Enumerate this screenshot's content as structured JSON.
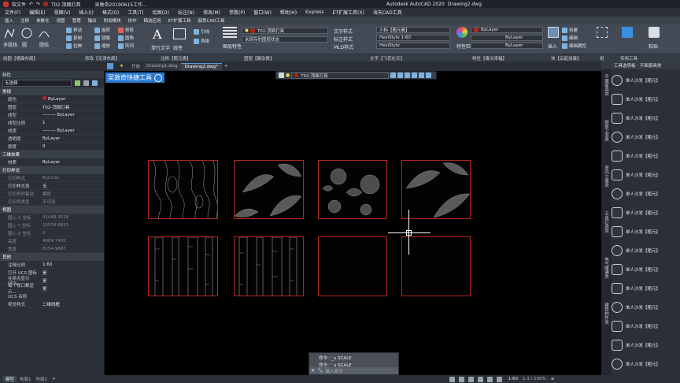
{
  "titlebar": {
    "app_title": "Autodesk AutoCAD 2020",
    "file": "Drawing2.dwg",
    "layer": "T02-顶面灯具",
    "doc": "吴敦奇20190615工作...",
    "product": "软文件"
  },
  "menu": [
    "文件(F)",
    "编辑(E)",
    "视图(V)",
    "插入(I)",
    "格式(O)",
    "工具(T)",
    "绘图(D)",
    "标注(N)",
    "修改(M)",
    "参数(P)",
    "窗口(W)",
    "帮助(H)",
    "Express",
    "ET扩展工具(X)",
    "海天CAD工具"
  ],
  "ribbon_tabs": [
    "插入",
    "注释",
    "参数化",
    "视图",
    "管理",
    "输出",
    "附加模块",
    "协作",
    "精选应用",
    "ET扩展工具",
    "赫思CAD工具"
  ],
  "ribbon": {
    "draw_tools": [
      "直线",
      "多段线",
      "圆",
      "圆弧"
    ],
    "modify": [
      "移动",
      "旋转",
      "修剪",
      "复制",
      "镜像",
      "圆角",
      "拉伸",
      "缩放",
      "阵列"
    ],
    "annot": [
      "单行文字",
      "线性",
      "引线",
      "表格"
    ],
    "layer_name": "T02-顶面灯具",
    "layer_state": "未保存的图层状态",
    "text_style_label": "文字样式",
    "text_style": "小标【粗元素】",
    "dim_style_label": "标注样式",
    "dim_style": "HesiStyle 1-60",
    "mld_label": "MLD样式",
    "mld_style": "HesiStyle",
    "bylayer1": "ByLayer",
    "bylayer2": "ByLayer",
    "bylayer3": "ByLayer",
    "block_tools": [
      "创建",
      "编辑",
      "编辑属性"
    ],
    "insert_label": "插入",
    "group_label": "组",
    "util_label": "实用工具",
    "paste_label": "粘贴",
    "layer_props_label": "图层特性",
    "match_label": "特性匹配"
  },
  "panel_labels": [
    "绘图【墙面布局】",
    "修改【无须布局】",
    "注释【粗元素】",
    "图层【聚杂数】",
    "文字【飞花在天】",
    "特性【毒次来幅】",
    "块【云起加奏】",
    "组",
    "实用工具"
  ],
  "doctabs": [
    "开始",
    "Drawing1.dwg",
    "Drawing2.dwg*"
  ],
  "watermark": "吴敦奇快捷工具",
  "props": {
    "title": "特性",
    "selection": "无选择",
    "general_title": "常规",
    "general": [
      [
        "颜色",
        "ByLayer"
      ],
      [
        "图层",
        "T02-顶面灯具"
      ],
      [
        "线型",
        "——— ByLayer"
      ],
      [
        "线型比例",
        "1"
      ],
      [
        "线宽",
        "——— ByLayer"
      ],
      [
        "透明度",
        "ByLayer"
      ],
      [
        "厚度",
        "0"
      ]
    ],
    "threed_title": "三维效果",
    "threed": [
      [
        "材质",
        "ByLayer"
      ]
    ],
    "plot_title": "打印样式",
    "plot": [
      [
        "打印样式",
        "ByColor"
      ],
      [
        "打印样式表",
        "无"
      ],
      [
        "打印表附着到",
        "模型"
      ],
      [
        "打印表类型",
        "不可用"
      ]
    ],
    "view_title": "视图",
    "view": [
      [
        "圆心 X 坐标",
        "41448.3528"
      ],
      [
        "圆心 Y 坐标",
        "15534.6831"
      ],
      [
        "圆心 Z 坐标",
        "0"
      ],
      [
        "高度",
        "4909.7462"
      ],
      [
        "宽度",
        "8154.9687"
      ]
    ],
    "misc_title": "其他",
    "misc": [
      [
        "注释比例",
        "1:60"
      ],
      [
        "打开 UCS 图标",
        "是"
      ],
      [
        "在原点显示 UCS...",
        "是"
      ],
      [
        "每个视口都显示...",
        "是"
      ],
      [
        "UCS 名称",
        ""
      ],
      [
        "视觉样式",
        "二维线框"
      ]
    ]
  },
  "float_toolbar": {
    "layer": "T02-顶面灯具"
  },
  "palette": {
    "header": "工具选项板 - 平面家具类",
    "item_label": "单人沙发【粗元】",
    "count": 16,
    "side_tabs": [
      "平面家具类",
      "厨房卫浴类",
      "室内立面类",
      "五金灯具类",
      "电气暖通类",
      "建筑构件类"
    ]
  },
  "command": {
    "history": [
      "命令: '_u SCALE",
      "命令: '_u SCALE"
    ],
    "placeholder": "键入命令"
  },
  "status": {
    "tabs": [
      "模型",
      "布局1",
      "布局2"
    ],
    "scale": "1:60",
    "zoom": "1:1 / 100%"
  },
  "colors": {
    "accent": "#2a7ad1",
    "frame": "#b3261e",
    "layer_swatch": "#a12b16"
  }
}
